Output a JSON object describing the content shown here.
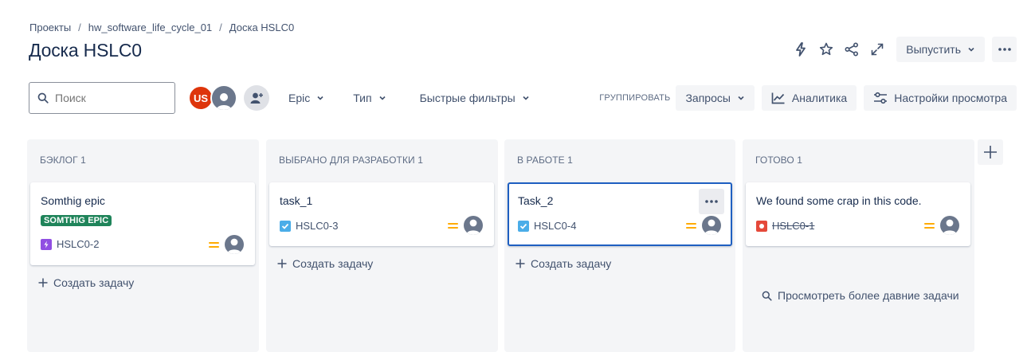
{
  "breadcrumb": {
    "items": [
      "Проекты",
      "hw_software_life_cycle_01",
      "Доска HSLC0"
    ],
    "separator": "/"
  },
  "page": {
    "title": "Доска HSLC0"
  },
  "top_actions": {
    "release_label": "Выпустить"
  },
  "filters": {
    "search_placeholder": "Поиск",
    "avatar_initials": "US",
    "epic_label": "Epic",
    "type_label": "Тип",
    "quick_filters_label": "Быстрые фильтры",
    "group_label": "ГРУППИРОВАТЬ",
    "group_value": "Запросы",
    "analytics_label": "Аналитика",
    "view_settings_label": "Настройки просмотра"
  },
  "colors": {
    "accent_blue": "#1e5fc1",
    "epic_green": "#1f845a",
    "avatar_red": "#de350b",
    "priority_orange": "#ffab00",
    "column_bg": "#f4f5f7",
    "subtask_purple": "#904ee2",
    "task_blue": "#4bade8",
    "bug_red": "#e5493a"
  },
  "columns": [
    {
      "title": "БЭКЛОГ 1",
      "card": {
        "title": "Somthig epic",
        "epic": "SOMTHIG EPIC",
        "key": "HSLC0-2",
        "type_icon": "subtask-lightning-icon",
        "done": false
      },
      "create_label": "Создать задачу"
    },
    {
      "title": "ВЫБРАНО ДЛЯ РАЗРАБОТКИ 1",
      "card": {
        "title": "task_1",
        "key": "HSLC0-3",
        "type_icon": "task-checkbox-icon",
        "done": false
      },
      "create_label": "Создать задачу"
    },
    {
      "title": "В РАБОТЕ 1",
      "card": {
        "title": "Task_2",
        "key": "HSLC0-4",
        "type_icon": "task-checkbox-icon",
        "done": false
      },
      "create_label": "Создать задачу"
    },
    {
      "title": "ГОТОВО 1",
      "card": {
        "title": "We found some crap in this code.",
        "key": "HSLC0-1",
        "type_icon": "bug-icon",
        "done": true
      },
      "older_label": "Просмотреть более давние задачи"
    }
  ]
}
